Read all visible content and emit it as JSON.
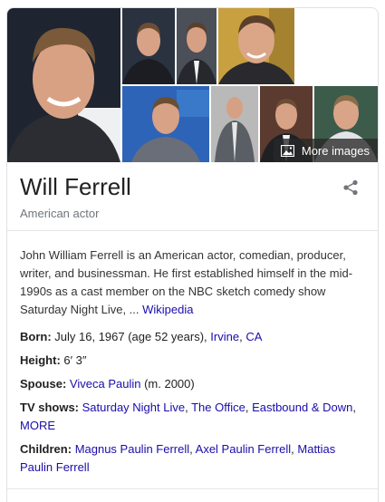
{
  "gallery": {
    "more_images_label": "More images",
    "photos": [
      {
        "name": "photo-main-portrait",
        "bg": "#1f2530"
      },
      {
        "name": "photo-2",
        "bg": "#2a3240"
      },
      {
        "name": "photo-3",
        "bg": "#4a4f58"
      },
      {
        "name": "photo-4",
        "bg": "#c8a040"
      },
      {
        "name": "photo-5",
        "bg": "#2d64b8"
      },
      {
        "name": "photo-6",
        "bg": "#b9b9b9"
      },
      {
        "name": "photo-7",
        "bg": "#5b3b2f"
      },
      {
        "name": "photo-8",
        "bg": "#3d5b4a"
      }
    ]
  },
  "entity": {
    "name": "Will Ferrell",
    "subtitle": "American actor"
  },
  "description": {
    "text": "John William Ferrell is an American actor, comedian, producer, writer, and businessman. He first established himself in the mid-1990s as a cast member on the NBC sketch comedy show Saturday Night Live, ... ",
    "source_link": "Wikipedia"
  },
  "facts": {
    "born": {
      "label": "Born:",
      "text": " July 16, 1967 (age 52 years), ",
      "link1": "Irvine",
      "sep": ", ",
      "link2": "CA"
    },
    "height": {
      "label": "Height:",
      "text": " 6′ 3″"
    },
    "spouse": {
      "label": "Spouse:",
      "link": "Viveca Paulin",
      "text": " (m. 2000)"
    },
    "tv_shows": {
      "label": "TV shows:",
      "link1": "Saturday Night Live",
      "link2": "The Office",
      "link3": "Eastbound & Down",
      "more": "MORE"
    },
    "children": {
      "label": "Children:",
      "link1": "Magnus Paulin Ferrell",
      "link2": "Axel Paulin Ferrell",
      "link3": "Mattias Paulin Ferrell"
    }
  },
  "colors": {
    "link": "#1a0dab",
    "muted": "#70757a",
    "border": "#dfe1e5"
  }
}
